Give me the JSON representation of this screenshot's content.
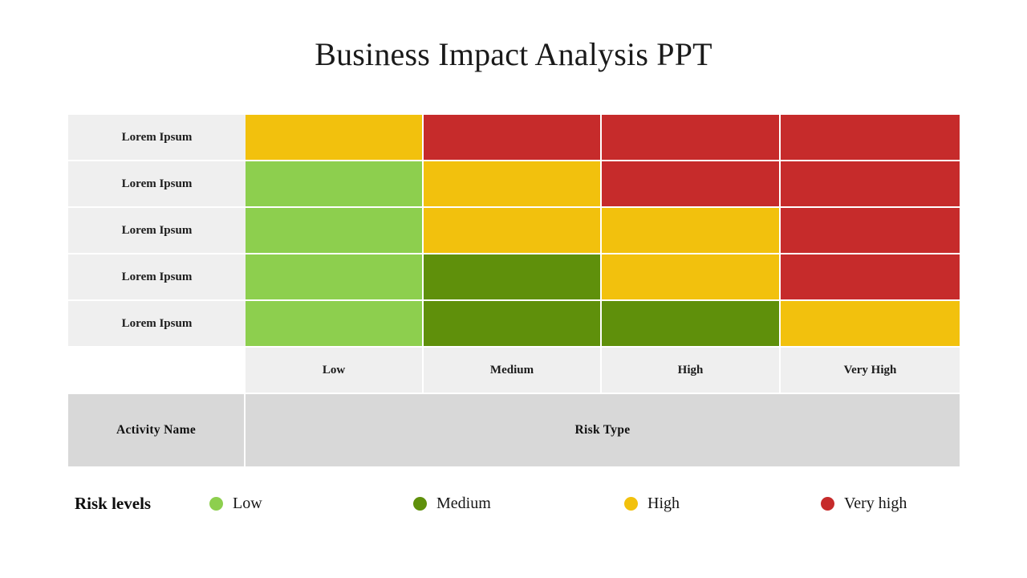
{
  "slide": {
    "title": "Business Impact Analysis PPT",
    "background": "#ffffff"
  },
  "colors": {
    "low": "#8DCF4E",
    "medium": "#5F900B",
    "high": "#F2C10D",
    "very_high": "#C62B2B",
    "row_label_bg": "#efefef",
    "col_header_bg": "#efefef",
    "footer_bg": "#d8d8d8",
    "grid_line": "#ffffff"
  },
  "matrix": {
    "row_labels": [
      "Lorem Ipsum",
      "Lorem Ipsum",
      "Lorem Ipsum",
      "Lorem Ipsum",
      "Lorem Ipsum"
    ],
    "column_headers": [
      "Low",
      "Medium",
      "High",
      "Very High"
    ],
    "cells": [
      [
        "high",
        "very_high",
        "very_high",
        "very_high"
      ],
      [
        "low",
        "high",
        "very_high",
        "very_high"
      ],
      [
        "low",
        "high",
        "high",
        "very_high"
      ],
      [
        "low",
        "medium",
        "high",
        "very_high"
      ],
      [
        "low",
        "medium",
        "medium",
        "high"
      ]
    ],
    "footer": {
      "activity_label": "Activity Name",
      "risk_label": "Risk Type"
    }
  },
  "legend": {
    "title": "Risk levels",
    "items": [
      {
        "label": "Low",
        "color_key": "low",
        "color": "#8DCF4E"
      },
      {
        "label": "Medium",
        "color_key": "medium",
        "color": "#5F900B"
      },
      {
        "label": "High",
        "color_key": "high",
        "color": "#F2C10D"
      },
      {
        "label": "Very high",
        "color_key": "very_high",
        "color": "#C62B2B"
      }
    ]
  },
  "chart_data": {
    "type": "heatmap",
    "title": "Business Impact Analysis PPT",
    "xlabel": "Risk Type",
    "ylabel": "Activity Name",
    "categories": [
      "Low",
      "Medium",
      "High",
      "Very High"
    ],
    "rows": [
      "Lorem Ipsum",
      "Lorem Ipsum",
      "Lorem Ipsum",
      "Lorem Ipsum",
      "Lorem Ipsum"
    ],
    "legend_position": "bottom",
    "grid": true,
    "scale": [
      "Low",
      "Medium",
      "High",
      "Very high"
    ],
    "values": [
      [
        "High",
        "Very high",
        "Very high",
        "Very high"
      ],
      [
        "Low",
        "High",
        "Very high",
        "Very high"
      ],
      [
        "Low",
        "High",
        "High",
        "Very high"
      ],
      [
        "Low",
        "Medium",
        "High",
        "Very high"
      ],
      [
        "Low",
        "Medium",
        "Medium",
        "High"
      ]
    ]
  }
}
